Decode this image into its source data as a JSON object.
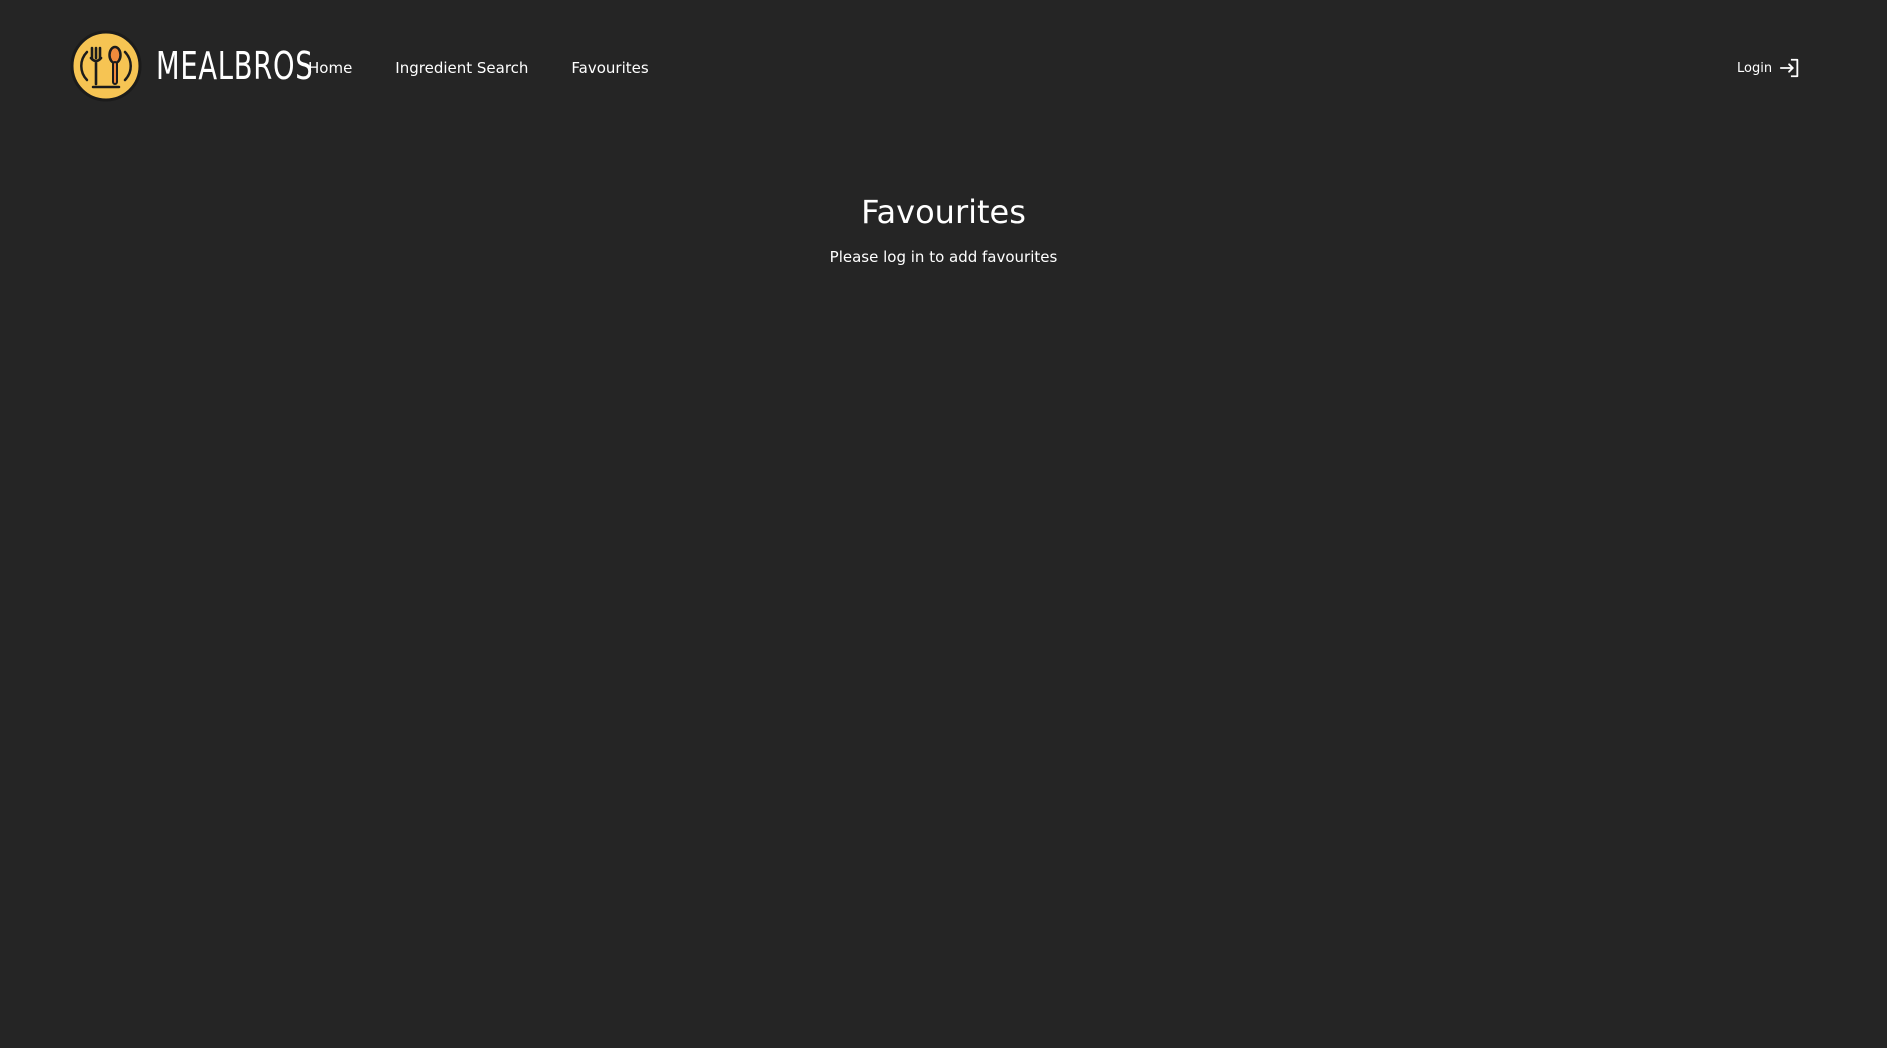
{
  "brand": {
    "name": "MEALBROS",
    "logo_icon": "fork-spoon-icon",
    "logo_color": "#f6c453"
  },
  "nav": {
    "items": [
      {
        "label": "Home"
      },
      {
        "label": "Ingredient Search"
      },
      {
        "label": "Favourites"
      }
    ]
  },
  "auth": {
    "login_label": "Login",
    "login_icon": "login-arrow-icon"
  },
  "main": {
    "title": "Favourites",
    "message": "Please log in to add favourites"
  },
  "colors": {
    "background": "#252525",
    "text": "#ffffff",
    "accent": "#f6c453"
  }
}
